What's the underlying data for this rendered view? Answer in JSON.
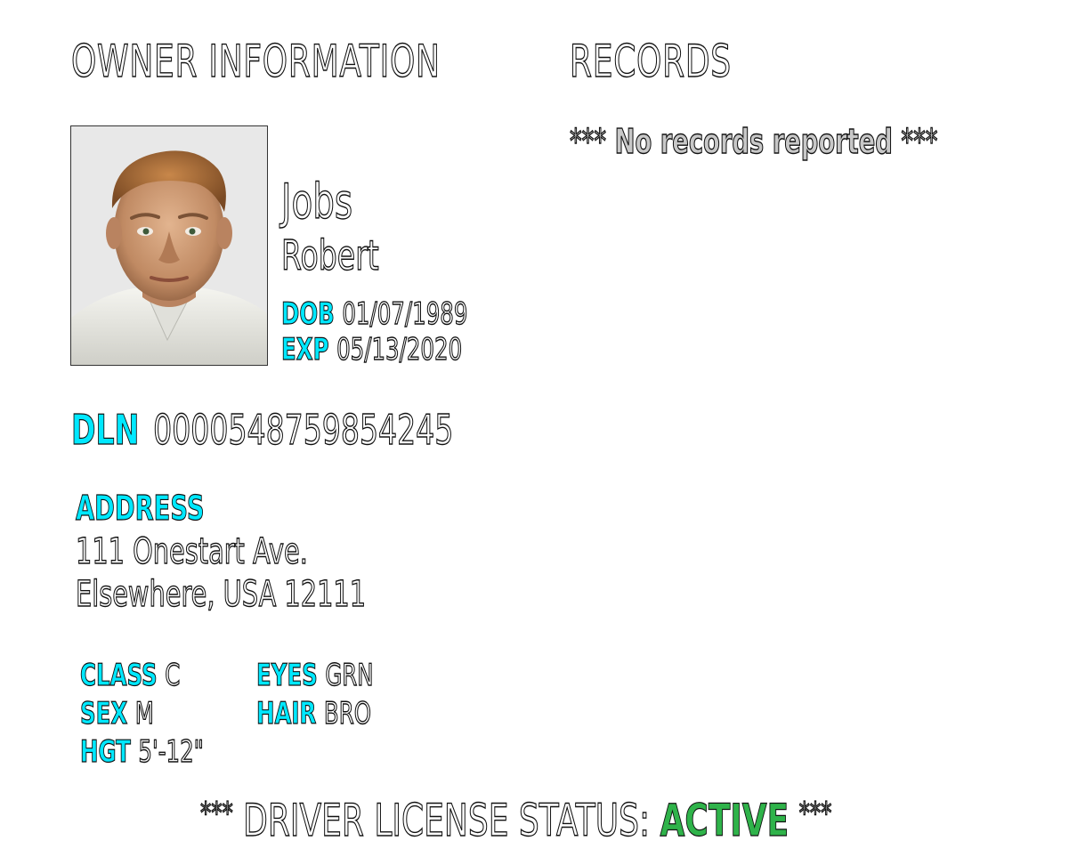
{
  "headings": {
    "owner": "OWNER INFORMATION",
    "records": "RECORDS"
  },
  "records": {
    "stars_left": "***",
    "message": "No records reported",
    "stars_right": "***"
  },
  "owner": {
    "last_name": "Jobs",
    "first_name": "Robert",
    "dob_label": "DOB",
    "dob": "01/07/1989",
    "exp_label": "EXP",
    "exp": "05/13/2020",
    "dln_label": "DLN",
    "dln": "0000548759854245",
    "address_label": "ADDRESS",
    "address_line1": "111 Onestart Ave.",
    "address_line2": "Elsewhere, USA 12111"
  },
  "attributes": {
    "class_label": "CLASS",
    "class": "C",
    "sex_label": "SEX",
    "sex": "M",
    "hgt_label": "HGT",
    "hgt": "5'-12\"",
    "eyes_label": "EYES",
    "eyes": "GRN",
    "hair_label": "HAIR",
    "hair": "BRO"
  },
  "status": {
    "stars_left": "***",
    "label": "DRIVER LICENSE STATUS:",
    "value": "ACTIVE",
    "stars_right": "***"
  },
  "colors": {
    "label_cyan": "#00e8ff",
    "active_green": "#2fb34a",
    "outline": "#111111"
  }
}
